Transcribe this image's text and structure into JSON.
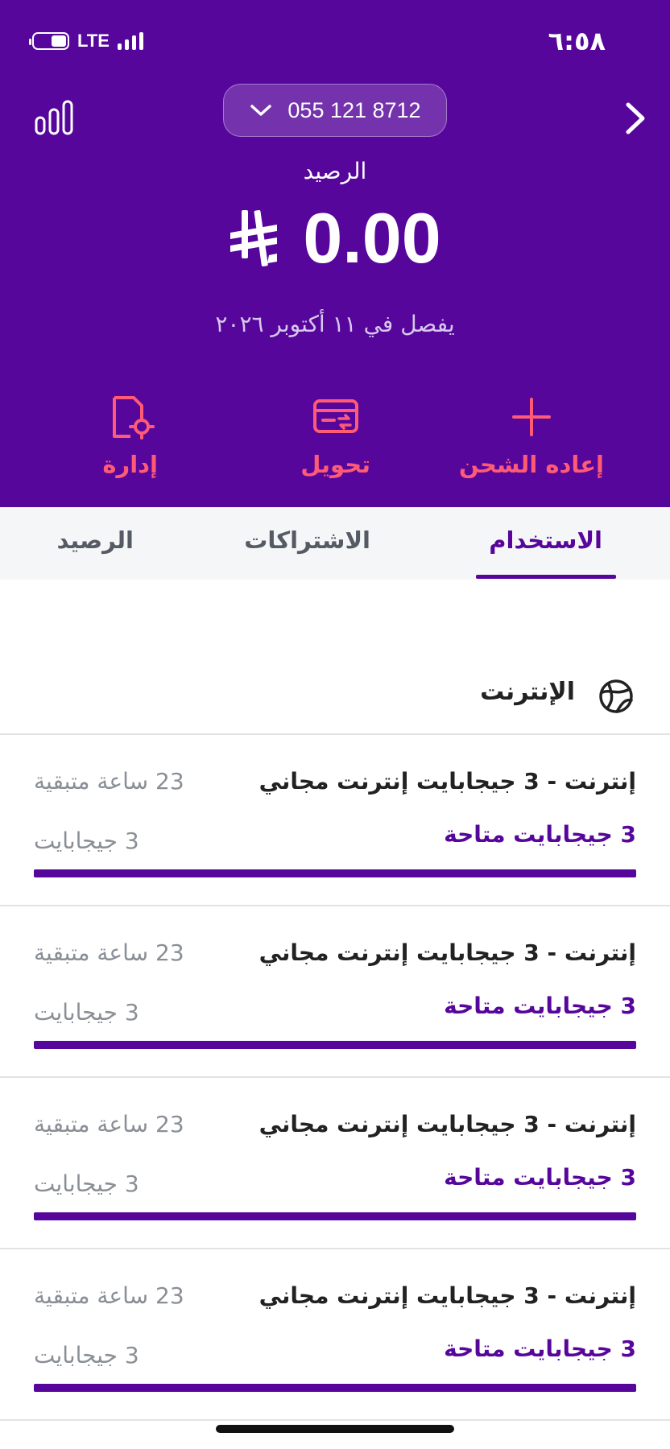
{
  "status_bar": {
    "time": "٦:٥٨",
    "network": "LTE"
  },
  "header": {
    "phone_number": "055 121 8712",
    "balance_label": "الرصيد",
    "balance_amount": "0.00",
    "expiry_text": "يفصل في ١١ أكتوبر ٢٠٢٦",
    "background_color": "#56069b"
  },
  "actions": [
    {
      "label": "إعاده الشحن",
      "icon": "plus-icon"
    },
    {
      "label": "تحويل",
      "icon": "card-transfer-icon"
    },
    {
      "label": "إدارة",
      "icon": "document-gear-icon"
    }
  ],
  "tabs": [
    {
      "label": "الاستخدام",
      "active": true
    },
    {
      "label": "الاشتراكات",
      "active": false
    },
    {
      "label": "الرصيد",
      "active": false
    }
  ],
  "section": {
    "title": "الإنترنت",
    "icon": "globe-icon"
  },
  "usage_items": [
    {
      "title": "إنترنت - 3 جيجابايت إنترنت مجاني",
      "available": "3 جيجابايت متاحة",
      "remaining_time": "23 ساعة متبقية",
      "total": "3 جيجابايت",
      "progress": 1.0
    },
    {
      "title": "إنترنت - 3 جيجابايت إنترنت مجاني",
      "available": "3 جيجابايت متاحة",
      "remaining_time": "23 ساعة متبقية",
      "total": "3 جيجابايت",
      "progress": 1.0
    },
    {
      "title": "إنترنت - 3 جيجابايت إنترنت مجاني",
      "available": "3 جيجابايت متاحة",
      "remaining_time": "23 ساعة متبقية",
      "total": "3 جيجابايت",
      "progress": 1.0
    },
    {
      "title": "إنترنت - 3 جيجابايت إنترنت مجاني",
      "available": "3 جيجابايت متاحة",
      "remaining_time": "23 ساعة متبقية",
      "total": "3 جيجابايت",
      "progress": 1.0
    }
  ],
  "colors": {
    "brand_purple": "#56069b",
    "action_red": "#ff5a76",
    "muted_text": "#8a8f96"
  }
}
